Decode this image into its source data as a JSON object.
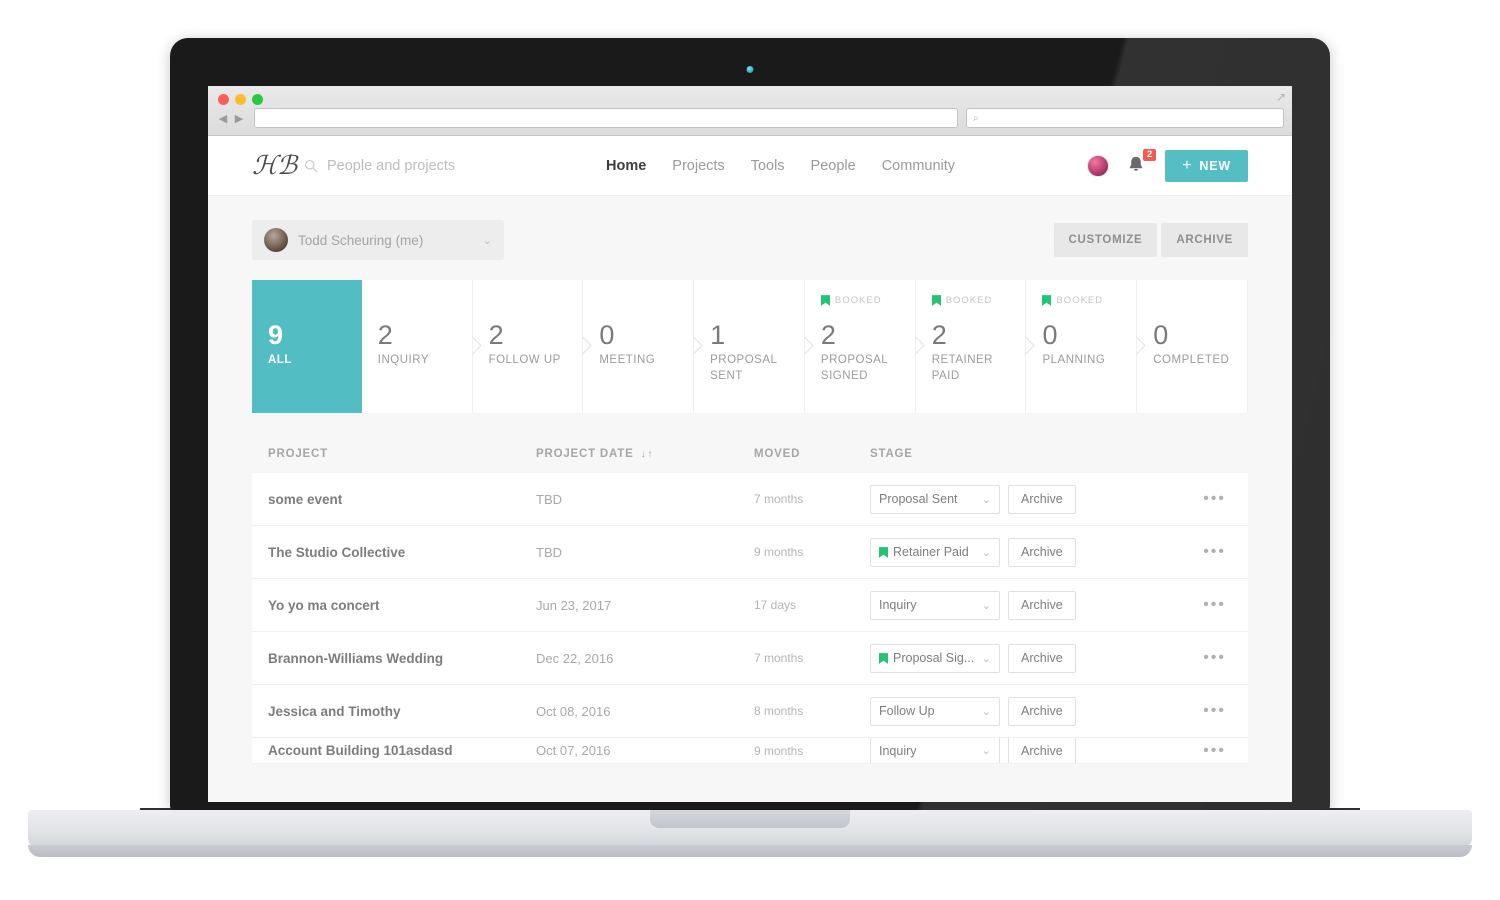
{
  "browser": {
    "url_value": "",
    "url_placeholder": "",
    "search_placeholder": "",
    "back_glyph": "◀",
    "forward_glyph": "▶",
    "search_glyph": "⌕"
  },
  "appbar": {
    "logo": "ℋℬ",
    "search_placeholder": "People and projects",
    "nav": [
      {
        "label": "Home",
        "active": true
      },
      {
        "label": "Projects",
        "active": false
      },
      {
        "label": "Tools",
        "active": false
      },
      {
        "label": "People",
        "active": false
      },
      {
        "label": "Community",
        "active": false
      }
    ],
    "notification_count": "2",
    "new_button": "NEW",
    "new_plus": "+"
  },
  "toolbar": {
    "user_name": "Todd Scheuring (me)",
    "caret": "⌄",
    "customize_label": "CUSTOMIZE",
    "archive_label": "ARCHIVE"
  },
  "pipeline": {
    "booked_label": "BOOKED",
    "cards": [
      {
        "count": "9",
        "label": "ALL",
        "booked": false,
        "active": true
      },
      {
        "count": "2",
        "label": "INQUIRY",
        "booked": false,
        "active": false
      },
      {
        "count": "2",
        "label": "FOLLOW UP",
        "booked": false,
        "active": false
      },
      {
        "count": "0",
        "label": "MEETING",
        "booked": false,
        "active": false
      },
      {
        "count": "1",
        "label": "PROPOSAL SENT",
        "booked": false,
        "active": false
      },
      {
        "count": "2",
        "label": "PROPOSAL SIGNED",
        "booked": true,
        "active": false
      },
      {
        "count": "2",
        "label": "RETAINER PAID",
        "booked": true,
        "active": false
      },
      {
        "count": "0",
        "label": "PLANNING",
        "booked": true,
        "active": false
      },
      {
        "count": "0",
        "label": "COMPLETED",
        "booked": false,
        "active": false
      }
    ]
  },
  "table": {
    "headers": {
      "project": "PROJECT",
      "project_date": "PROJECT DATE",
      "moved": "MOVED",
      "stage": "STAGE"
    },
    "sort_down": "↓",
    "sort_up": "↑",
    "archive_label": "Archive",
    "dots": "•••",
    "select_caret": "⌄",
    "rows": [
      {
        "project": "some event",
        "date": "TBD",
        "moved": "7 months",
        "stage": "Proposal Sent",
        "booked": false
      },
      {
        "project": "The Studio Collective",
        "date": "TBD",
        "moved": "9 months",
        "stage": "Retainer Paid",
        "booked": true
      },
      {
        "project": "Yo yo ma concert",
        "date": "Jun 23, 2017",
        "moved": "17 days",
        "stage": "Inquiry",
        "booked": false
      },
      {
        "project": "Brannon-Williams Wedding",
        "date": "Dec 22, 2016",
        "moved": "7 months",
        "stage": "Proposal Sig...",
        "booked": true
      },
      {
        "project": "Jessica and Timothy",
        "date": "Oct 08, 2016",
        "moved": "8 months",
        "stage": "Follow Up",
        "booked": false
      },
      {
        "project": "Account Building 101asdasd",
        "date": "Oct 07, 2016",
        "moved": "9 months",
        "stage": "Inquiry",
        "booked": false
      }
    ]
  },
  "colors": {
    "teal": "#52bec4",
    "green_flag": "#22c573",
    "badge_red": "#f45b4e",
    "page_bg": "#f7f7f7"
  }
}
